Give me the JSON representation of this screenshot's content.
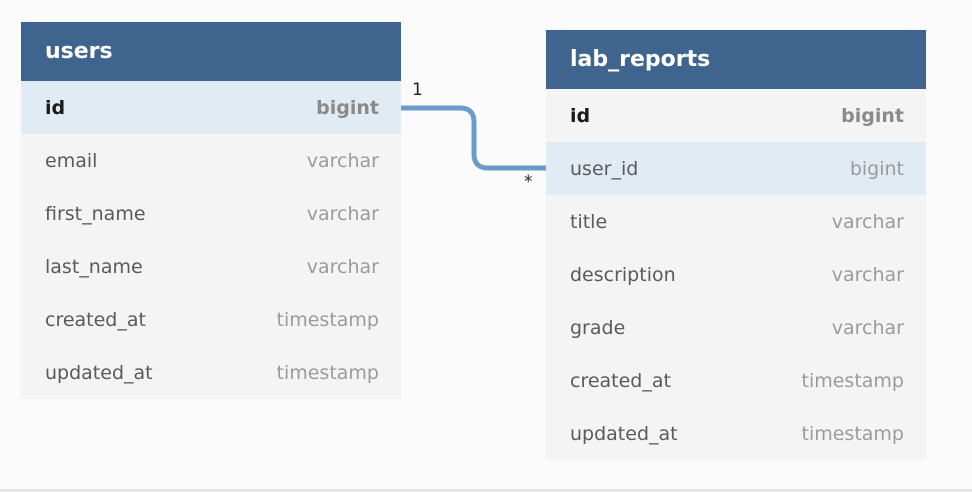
{
  "tables": {
    "users": {
      "name": "users",
      "columns": [
        {
          "name": "id",
          "type": "bigint"
        },
        {
          "name": "email",
          "type": "varchar"
        },
        {
          "name": "first_name",
          "type": "varchar"
        },
        {
          "name": "last_name",
          "type": "varchar"
        },
        {
          "name": "created_at",
          "type": "timestamp"
        },
        {
          "name": "updated_at",
          "type": "timestamp"
        }
      ]
    },
    "lab_reports": {
      "name": "lab_reports",
      "columns": [
        {
          "name": "id",
          "type": "bigint"
        },
        {
          "name": "user_id",
          "type": "bigint"
        },
        {
          "name": "title",
          "type": "varchar"
        },
        {
          "name": "description",
          "type": "varchar"
        },
        {
          "name": "grade",
          "type": "varchar"
        },
        {
          "name": "created_at",
          "type": "timestamp"
        },
        {
          "name": "updated_at",
          "type": "timestamp"
        }
      ]
    }
  },
  "relationship": {
    "from_cardinality": "1",
    "to_cardinality": "*"
  },
  "colors": {
    "header": "#3f648e",
    "highlight": "#e1ebf3",
    "connector": "#6b9bcb"
  }
}
